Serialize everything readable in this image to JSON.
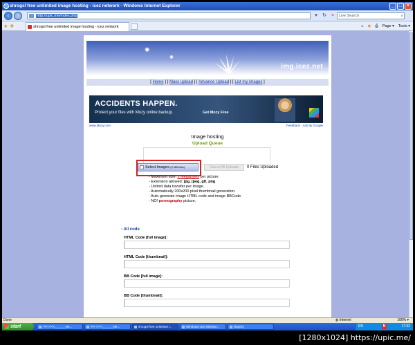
{
  "window": {
    "title": "shrogsl free unlimited image hosting - icez network - Windows Internet Explorer",
    "controls": [
      "_",
      "□",
      "×"
    ]
  },
  "address_bar": {
    "url": "http://upic.me/index.php",
    "search_placeholder": "Live Search"
  },
  "tab": {
    "label": "shrogsl free unlimited image hosting - icez network"
  },
  "commandbar": {
    "items": [
      "Page ▾",
      "Tools ▾"
    ]
  },
  "site": {
    "logo": "img.icez.net",
    "nav": [
      "Home",
      "Mass upload",
      "Advance Upload",
      "List my images"
    ]
  },
  "ad": {
    "headline": "ACCIDENTS HAPPEN.",
    "subline": "Protect your files with Mozy online backup.",
    "cta": "Get Mozy Free",
    "source": "www.Mozy.com",
    "footer_right": "Feedback · Ads by Google"
  },
  "upload": {
    "title": "Image hosting",
    "queue_label": "Upload Queue",
    "select_label": "Select Images",
    "select_note": "(2 MB Max)",
    "cancel_label": "Cancel All Uploads",
    "files_uploaded": "0 Files Uploaded",
    "rules": {
      "max_prefix": "- Maximum size: ",
      "max_link": "2 Megabytes",
      "max_suffix": " per picture.",
      "ext_prefix": "- Extension allowed: ",
      "ext_values": "jpg, jpeg, gif, png",
      "unlimited": "- Unlimit data transfer per image.",
      "thumbnail": "- Automatically 200x200 pixel thumbnail generation.",
      "autogen": "- Auto generate image HTML code and image BBCode.",
      "no_prefix": "- NO! ",
      "no_word": "pornography",
      "no_suffix": " picture."
    }
  },
  "codes": {
    "all_code": "- All code",
    "html_full": "HTML Code [full image]:",
    "html_thumb": "HTML Code [thumbnail]:",
    "bb_full": "BB Code [full image]:",
    "bb_thumb": "BB Code [thumbnail]:"
  },
  "statusbar": {
    "left": "Done",
    "zone": "Internet",
    "zoom": "100% ▾"
  },
  "taskbar": {
    "start": "start",
    "tasks": [
      "?•> >'<'<______Ne...",
      "?•> >'<'<______Ne...",
      "shrogsl free unlimited i...",
      "Windows Live Messen...",
      "Raycity"
    ],
    "lang": "EN",
    "clock": "17:32"
  },
  "caption": "[1280x1024] https://upic.me/"
}
